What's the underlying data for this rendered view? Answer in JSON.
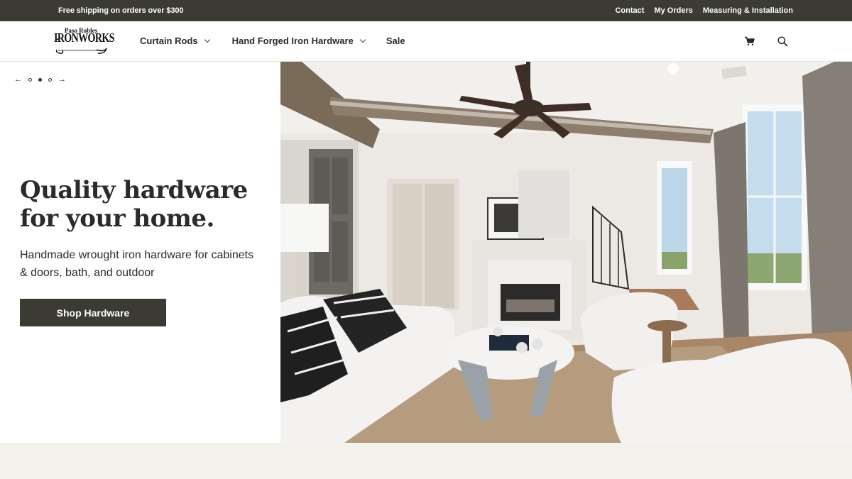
{
  "topbar": {
    "promo": "Free shipping on orders over $300",
    "links": [
      "Contact",
      "My Orders",
      "Measuring & Installation"
    ]
  },
  "header": {
    "logo_line1": "Paso Robles",
    "logo_line2": "IRONWORKS",
    "nav": [
      {
        "label": "Curtain Rods",
        "has_dropdown": true
      },
      {
        "label": "Hand Forged Iron Hardware",
        "has_dropdown": true
      },
      {
        "label": "Sale",
        "has_dropdown": false
      }
    ],
    "icons": [
      "cart-icon",
      "search-icon"
    ]
  },
  "hero": {
    "slider": {
      "total": 3,
      "active": 2
    },
    "headline_line1": "Quality hardware",
    "headline_line2": "for your home.",
    "subtext": "Handmade wrought iron hardware for cabinets & doors, bath, and outdoor",
    "cta_label": "Shop Hardware"
  },
  "colors": {
    "dark": "#3b3a33",
    "page_bg": "#f3f1ec",
    "text": "#2b2b27"
  }
}
